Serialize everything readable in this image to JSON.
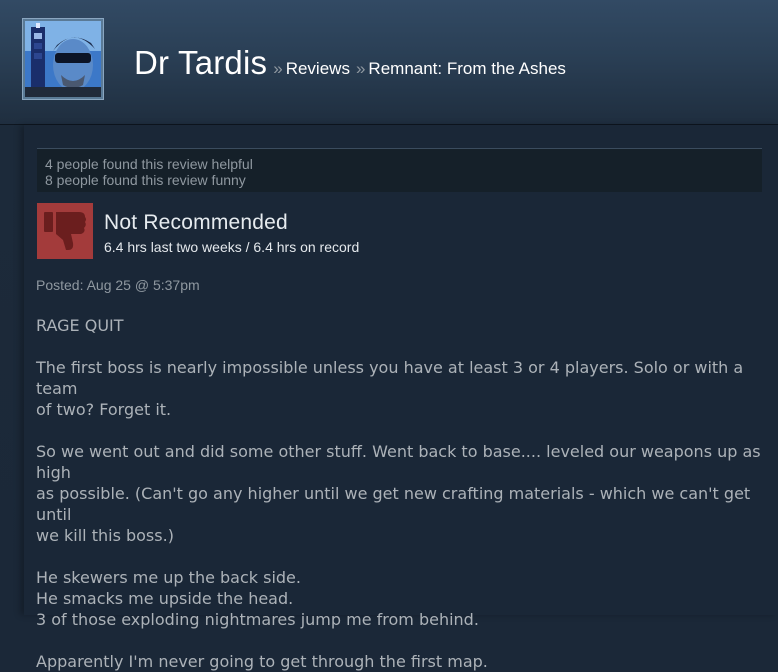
{
  "header": {
    "persona_name": "Dr Tardis",
    "separator": "»",
    "breadcrumbs": [
      "Reviews",
      "Remnant: From the Ashes"
    ]
  },
  "review": {
    "helpful_lines": [
      "4 people found this review helpful",
      "8 people found this review funny"
    ],
    "verdict": "Not Recommended",
    "hours": "6.4 hrs last two weeks / 6.4 hrs on record",
    "posted": "Posted: Aug 25 @ 5:37pm",
    "body": [
      [
        "RAGE QUIT"
      ],
      [
        "The first boss is nearly impossible unless you have at least 3 or 4 players. Solo or with a team",
        "of two? Forget it."
      ],
      [
        "So we went out and did some other stuff. Went back to base.... leveled our weapons up as high",
        "as possible. (Can't go any higher until we get new crafting materials - which we can't get until",
        "we kill this boss.)"
      ],
      [
        "He skewers me up the back side.",
        "He smacks me upside the head.",
        "3 of those exploding nightmares jump me from behind."
      ],
      [
        "Apparently I'm never going to get through the first map."
      ]
    ]
  },
  "icons": {
    "avatar": "user-avatar-tardis",
    "verdict_icon": "thumbs-down-icon"
  },
  "colors": {
    "background": "#1b2838",
    "thumbs_down_bg": "#a33b3b",
    "review_text": "#acb2b8",
    "muted_text": "#8f98a0"
  }
}
